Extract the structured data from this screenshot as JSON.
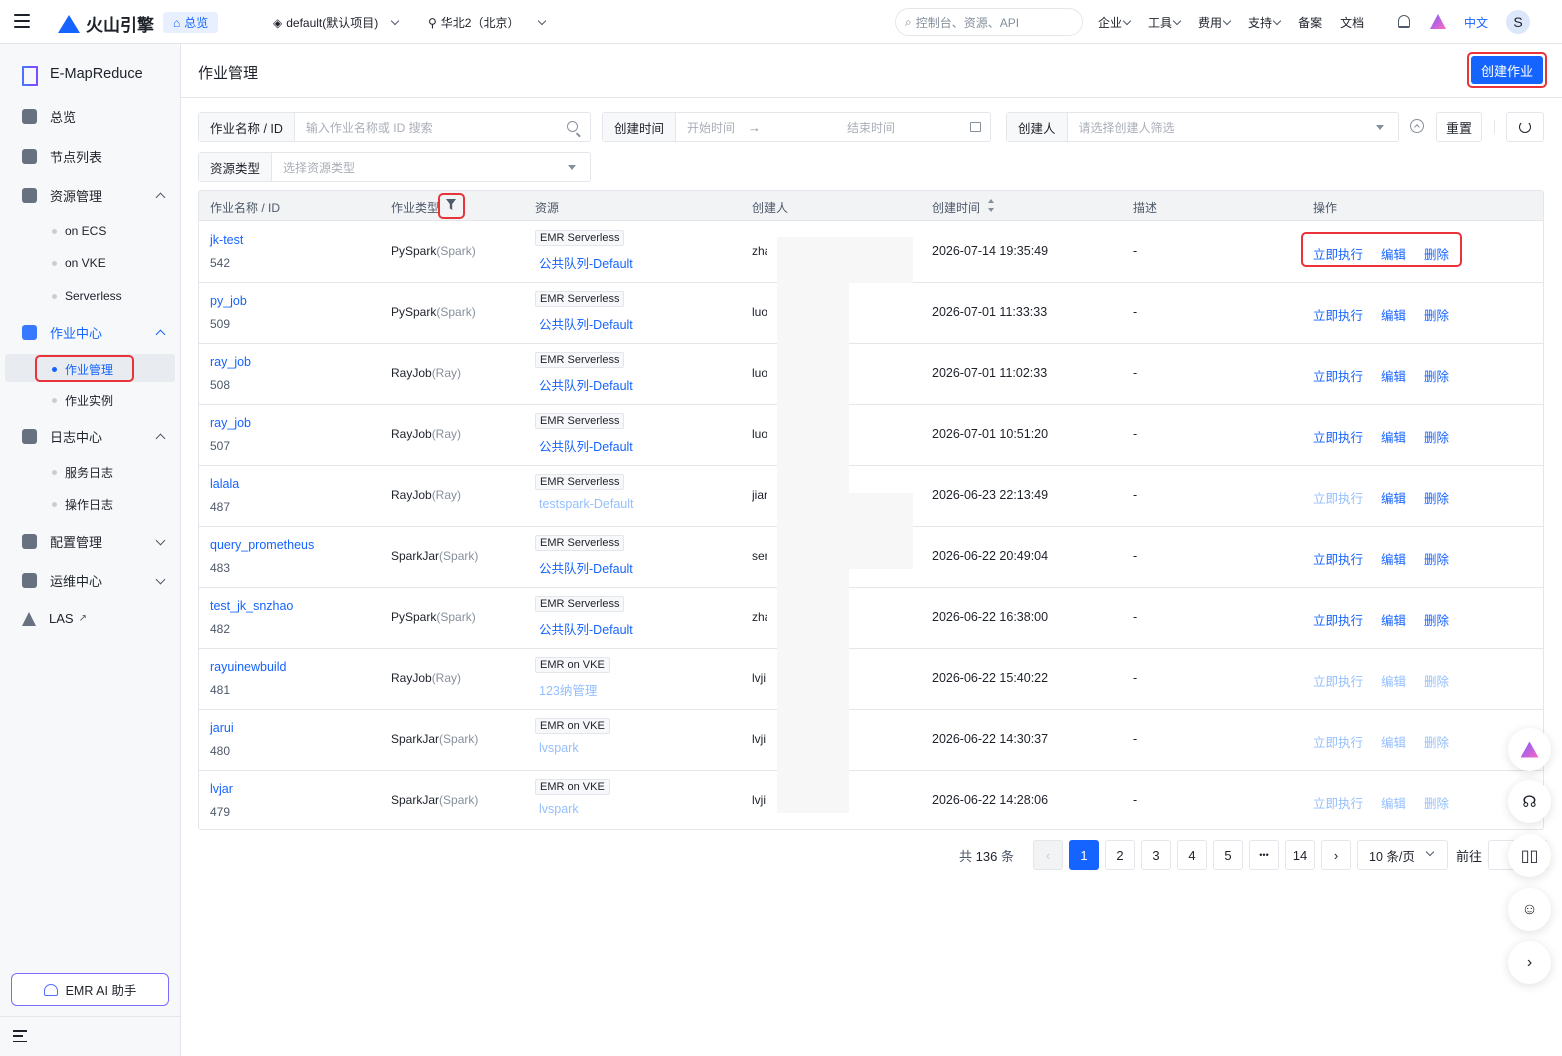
{
  "topbar": {
    "brand": "火山引擎",
    "overview": "总览",
    "project": "default(默认项目)",
    "region": "华北2（北京）",
    "search_placeholder": "控制台、资源、API",
    "menu": [
      "企业",
      "工具",
      "费用",
      "支持",
      "备案",
      "文档"
    ],
    "lang": "中文",
    "avatar": "S"
  },
  "sidebar": {
    "title": "E-MapReduce",
    "items": [
      {
        "label": "总览"
      },
      {
        "label": "节点列表"
      },
      {
        "label": "资源管理"
      },
      {
        "label": "作业中心"
      },
      {
        "label": "日志中心"
      },
      {
        "label": "配置管理"
      },
      {
        "label": "运维中心"
      },
      {
        "label": "LAS"
      }
    ],
    "resource_subs": [
      "on ECS",
      "on VKE",
      "Serverless"
    ],
    "job_subs": [
      "作业管理",
      "作业实例"
    ],
    "log_subs": [
      "服务日志",
      "操作日志"
    ],
    "ai_button": "EMR AI 助手"
  },
  "page": {
    "title": "作业管理",
    "create_button": "创建作业"
  },
  "filters": {
    "name_label": "作业名称 / ID",
    "name_placeholder": "输入作业名称或 ID 搜索",
    "time_label": "创建时间",
    "start_placeholder": "开始时间",
    "end_placeholder": "结束时间",
    "creator_label": "创建人",
    "creator_placeholder": "请选择创建人筛选",
    "reset": "重置",
    "restype_label": "资源类型",
    "restype_placeholder": "选择资源类型"
  },
  "table": {
    "columns": [
      "作业名称 / ID",
      "作业类型",
      "资源",
      "创建人",
      "创建时间",
      "描述",
      "操作"
    ],
    "rows": [
      {
        "name": "jk-test",
        "id": "542",
        "type": "PySpark",
        "engine": "(Spark)",
        "tag": "EMR Serverless",
        "res": "公共队列-Default",
        "res_dim": false,
        "creator": "zha",
        "time": "2026-07-14 19:35:49",
        "desc": "-",
        "run": "立即执行",
        "edit": "编辑",
        "del": "删除",
        "run_dim": false,
        "edit_dim": false
      },
      {
        "name": "py_job",
        "id": "509",
        "type": "PySpark",
        "engine": "(Spark)",
        "tag": "EMR Serverless",
        "res": "公共队列-Default",
        "res_dim": false,
        "creator": "luo",
        "time": "2026-07-01 11:33:33",
        "desc": "-",
        "run": "立即执行",
        "edit": "编辑",
        "del": "删除",
        "run_dim": false,
        "edit_dim": false
      },
      {
        "name": "ray_job",
        "id": "508",
        "type": "RayJob",
        "engine": "(Ray)",
        "tag": "EMR Serverless",
        "res": "公共队列-Default",
        "res_dim": false,
        "creator": "luo",
        "time": "2026-07-01 11:02:33",
        "desc": "-",
        "run": "立即执行",
        "edit": "编辑",
        "del": "删除",
        "run_dim": false,
        "edit_dim": false
      },
      {
        "name": "ray_job",
        "id": "507",
        "type": "RayJob",
        "engine": "(Ray)",
        "tag": "EMR Serverless",
        "res": "公共队列-Default",
        "res_dim": false,
        "creator": "luo",
        "time": "2026-07-01 10:51:20",
        "desc": "-",
        "run": "立即执行",
        "edit": "编辑",
        "del": "删除",
        "run_dim": false,
        "edit_dim": false
      },
      {
        "name": "lalala",
        "id": "487",
        "type": "RayJob",
        "engine": "(Ray)",
        "tag": "EMR Serverless",
        "res": "testspark-Default",
        "res_dim": true,
        "creator": "jiar",
        "time": "2026-06-23 22:13:49",
        "desc": "-",
        "run": "立即执行",
        "edit": "编辑",
        "del": "删除",
        "run_dim": true,
        "edit_dim": false
      },
      {
        "name": "query_prometheus",
        "id": "483",
        "type": "SparkJar",
        "engine": "(Spark)",
        "tag": "EMR Serverless",
        "res": "公共队列-Default",
        "res_dim": false,
        "creator": "ser",
        "time": "2026-06-22 20:49:04",
        "desc": "-",
        "run": "立即执行",
        "edit": "编辑",
        "del": "删除",
        "run_dim": false,
        "edit_dim": false
      },
      {
        "name": "test_jk_snzhao",
        "id": "482",
        "type": "PySpark",
        "engine": "(Spark)",
        "tag": "EMR Serverless",
        "res": "公共队列-Default",
        "res_dim": false,
        "creator": "zha",
        "time": "2026-06-22 16:38:00",
        "desc": "-",
        "run": "立即执行",
        "edit": "编辑",
        "del": "删除",
        "run_dim": false,
        "edit_dim": false
      },
      {
        "name": "rayuinewbuild",
        "id": "481",
        "type": "RayJob",
        "engine": "(Ray)",
        "tag": "EMR on VKE",
        "res": "123纳管理",
        "res_dim": true,
        "creator": "lvji",
        "time": "2026-06-22 15:40:22",
        "desc": "-",
        "run": "立即执行",
        "edit": "编辑",
        "del": "删除",
        "run_dim": true,
        "edit_dim": true
      },
      {
        "name": "jarui",
        "id": "480",
        "type": "SparkJar",
        "engine": "(Spark)",
        "tag": "EMR on VKE",
        "res": "lvspark",
        "res_dim": true,
        "creator": "lvji",
        "time": "2026-06-22 14:30:37",
        "desc": "-",
        "run": "立即执行",
        "edit": "编辑",
        "del": "删除",
        "run_dim": true,
        "edit_dim": true
      },
      {
        "name": "lvjar",
        "id": "479",
        "type": "SparkJar",
        "engine": "(Spark)",
        "tag": "EMR on VKE",
        "res": "lvspark",
        "res_dim": true,
        "creator": "lvji",
        "time": "2026-06-22 14:28:06",
        "desc": "-",
        "run": "立即执行",
        "edit": "编辑",
        "del": "删除",
        "run_dim": true,
        "edit_dim": true
      }
    ]
  },
  "pagination": {
    "total_prefix": "共",
    "total": "136",
    "total_suffix": "条",
    "pages": [
      "1",
      "2",
      "3",
      "4",
      "5",
      "•••",
      "14"
    ],
    "current": "1",
    "page_size": "10 条/页",
    "goto": "前往"
  },
  "colors": {
    "primary": "#1664ff",
    "dim_link": "#94bffe",
    "highlight": "#e8333a"
  }
}
